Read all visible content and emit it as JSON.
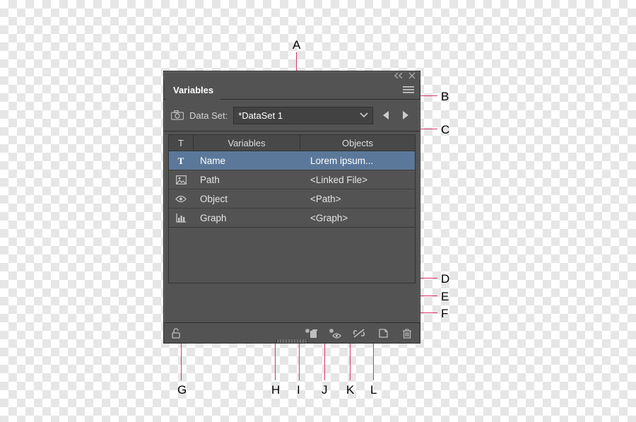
{
  "callouts": {
    "A": "A",
    "B": "B",
    "C": "C",
    "D": "D",
    "E": "E",
    "F": "F",
    "G": "G",
    "H": "H",
    "I": "I",
    "J": "J",
    "K": "K",
    "L": "L"
  },
  "panel": {
    "tab_label": "Variables",
    "data_set_label": "Data Set:",
    "data_set_value": "*DataSet 1",
    "columns": {
      "type": "T",
      "variables": "Variables",
      "objects": "Objects"
    },
    "rows": [
      {
        "icon": "text",
        "variable": "Name",
        "object": "Lorem ipsum...",
        "selected": true
      },
      {
        "icon": "image",
        "variable": "Path",
        "object": "<Linked File>",
        "selected": false
      },
      {
        "icon": "eye",
        "variable": "Object",
        "object": "<Path>",
        "selected": false
      },
      {
        "icon": "graph",
        "variable": "Graph",
        "object": "<Graph>",
        "selected": false
      }
    ]
  }
}
